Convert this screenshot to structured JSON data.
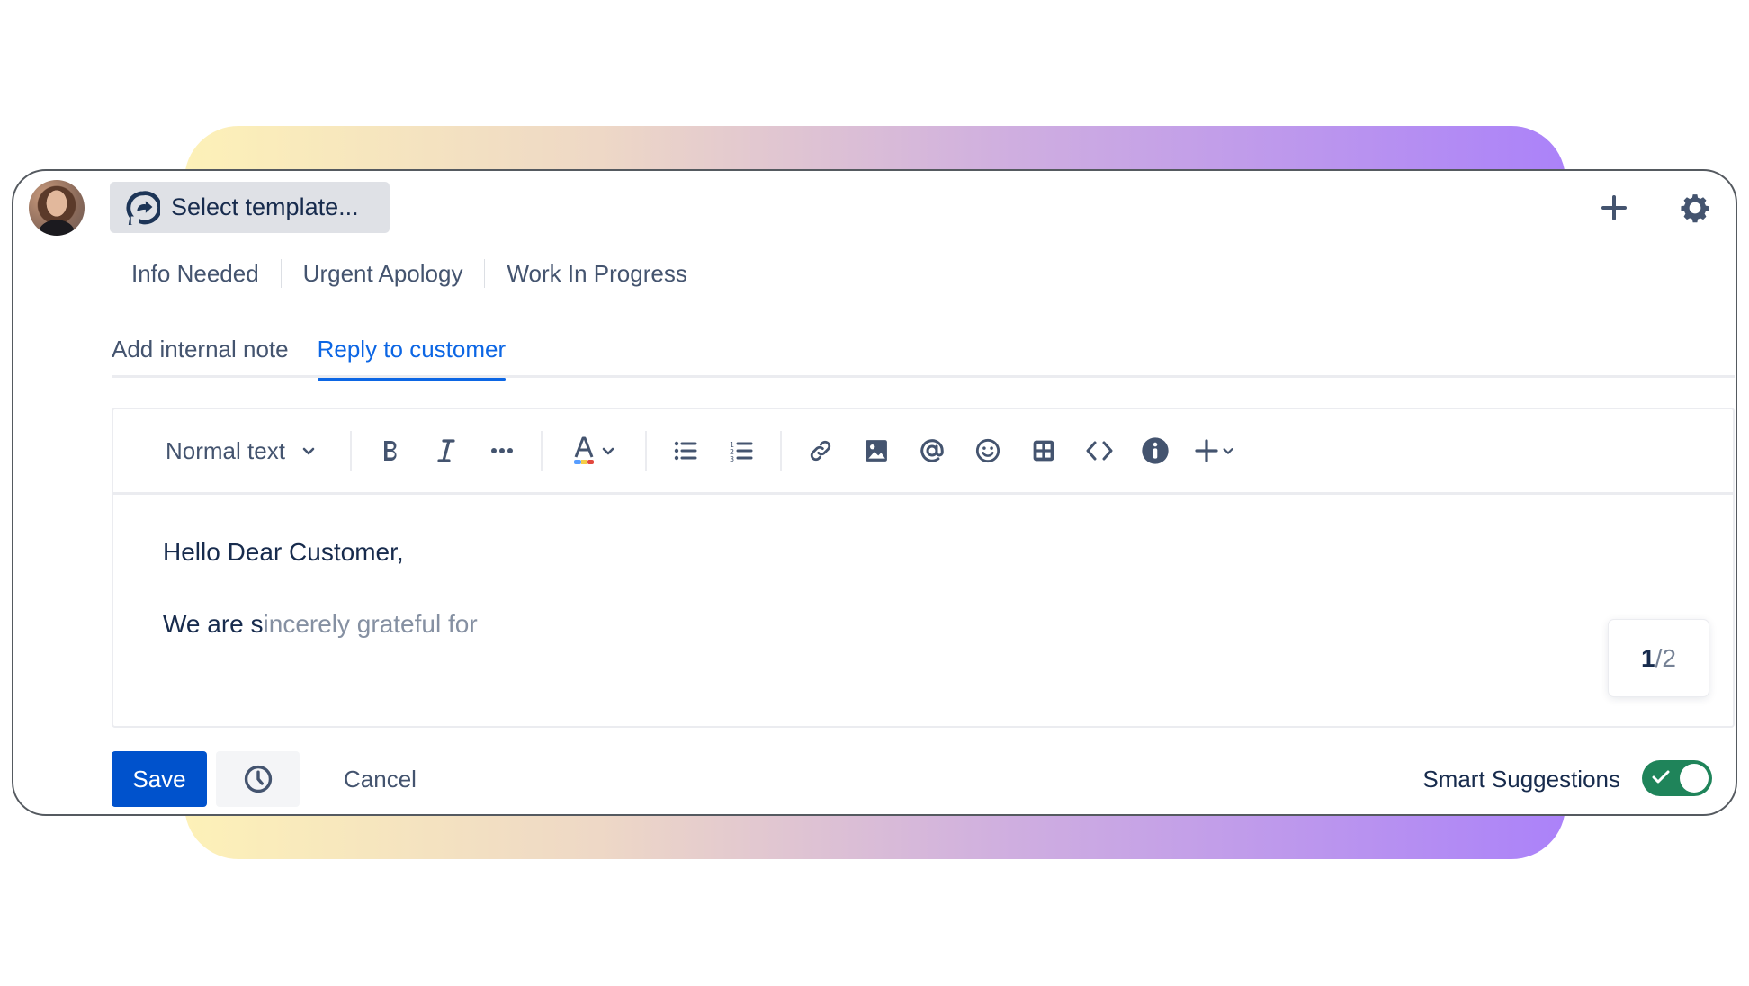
{
  "header": {
    "avatar_alt": "User avatar",
    "template_select_label": "Select template...",
    "template_icon": "template-logo-icon",
    "add_icon": "plus-icon",
    "settings_icon": "gear-icon"
  },
  "quick_templates": [
    {
      "label": "Info Needed"
    },
    {
      "label": "Urgent Apology"
    },
    {
      "label": "Work In Progress"
    }
  ],
  "tabs": [
    {
      "label": "Add internal note",
      "active": false
    },
    {
      "label": "Reply to customer",
      "active": true
    }
  ],
  "toolbar": {
    "text_style": "Normal text",
    "buttons": [
      {
        "name": "bold",
        "icon": "bold-icon"
      },
      {
        "name": "italic",
        "icon": "italic-icon"
      },
      {
        "name": "more-formatting",
        "icon": "more-icon"
      },
      {
        "name": "text-color",
        "icon": "text-color-icon"
      },
      {
        "name": "bullet-list",
        "icon": "bullet-list-icon"
      },
      {
        "name": "numbered-list",
        "icon": "numbered-list-icon"
      },
      {
        "name": "link",
        "icon": "link-icon"
      },
      {
        "name": "image",
        "icon": "image-icon"
      },
      {
        "name": "mention",
        "icon": "mention-icon"
      },
      {
        "name": "emoji",
        "icon": "emoji-icon"
      },
      {
        "name": "table",
        "icon": "table-icon"
      },
      {
        "name": "code",
        "icon": "code-icon"
      },
      {
        "name": "info-panel",
        "icon": "info-icon"
      },
      {
        "name": "insert",
        "icon": "plus-icon"
      }
    ]
  },
  "editor": {
    "line1": "Hello Dear Customer,",
    "line2_typed": "We are s",
    "line2_suggestion": "incerely grateful for"
  },
  "suggestion_counter": {
    "current": "1",
    "separator": "/",
    "total": "2"
  },
  "footer": {
    "save_label": "Save",
    "schedule_icon": "clock-icon",
    "cancel_label": "Cancel",
    "smart_suggestions_label": "Smart Suggestions",
    "smart_suggestions_enabled": true
  },
  "colors": {
    "primary": "#0052CC",
    "active_tab": "#0C66E4",
    "toggle_on": "#1F845A",
    "text": "#172B4D",
    "subtle_text": "#44546F",
    "ghost_text": "#8590A2"
  }
}
